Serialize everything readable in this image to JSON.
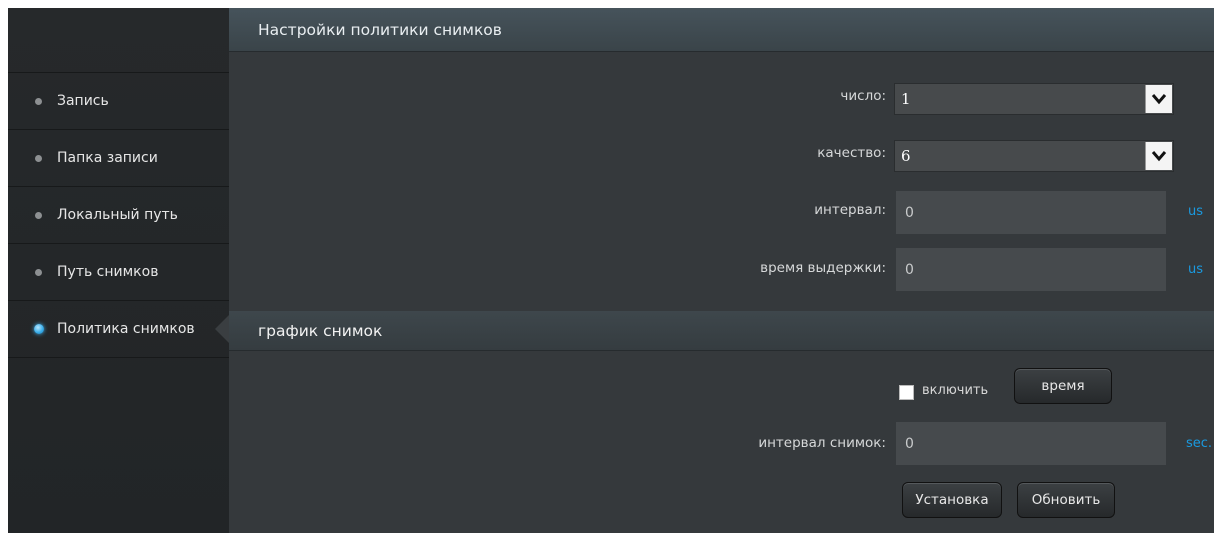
{
  "sidebar": {
    "items": [
      {
        "label": "Запись",
        "active": false
      },
      {
        "label": "Папка записи",
        "active": false
      },
      {
        "label": "Локальный путь",
        "active": false
      },
      {
        "label": "Путь снимков",
        "active": false
      },
      {
        "label": "Политика снимков",
        "active": true
      }
    ]
  },
  "policy": {
    "title": "Настройки политики снимков",
    "count_label": "число:",
    "count_value": "1",
    "quality_label": "качество:",
    "quality_value": "6",
    "interval_label": "интервал:",
    "interval_value": "0",
    "interval_unit": "us",
    "exposure_label": "время выдержки:",
    "exposure_value": "0",
    "exposure_unit": "us"
  },
  "schedule": {
    "title": "график снимок",
    "enable_label": "включить",
    "enable_checked": false,
    "time_button": "время",
    "snap_interval_label": "интервал снимок:",
    "snap_interval_value": "0",
    "snap_interval_unit": "sec."
  },
  "actions": {
    "apply_label": "Установка",
    "refresh_label": "Обновить"
  },
  "colors": {
    "accent": "#1a9ae0",
    "header": "#46535b",
    "panel": "#35393c",
    "sidebar": "#26292b"
  }
}
